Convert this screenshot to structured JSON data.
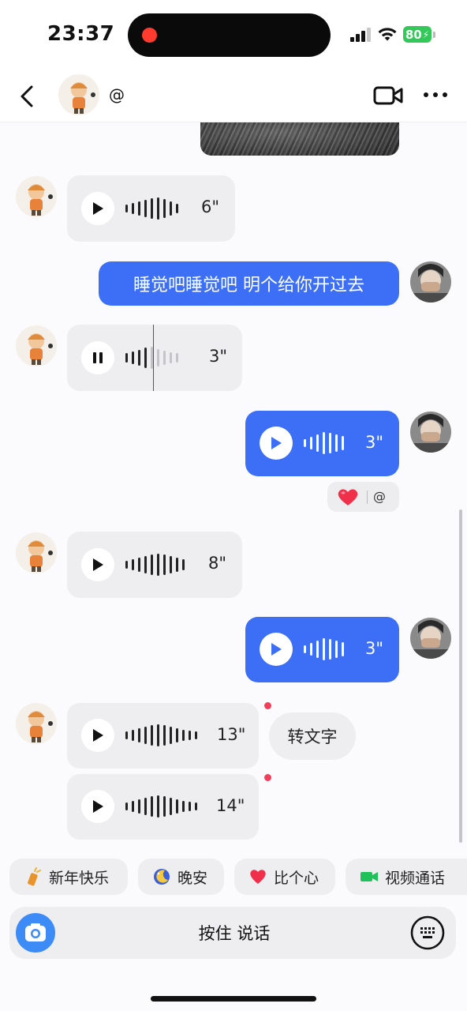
{
  "status_bar": {
    "time": "23:37",
    "battery": "80",
    "icons": [
      "signal-icon",
      "wifi-icon",
      "battery-charging-icon"
    ]
  },
  "header": {
    "contact_name": "@",
    "icons": [
      "back-arrow-icon",
      "video-camera-icon",
      "more-dots-icon"
    ]
  },
  "messages": [
    {
      "from": "me",
      "type": "image"
    },
    {
      "from": "them",
      "type": "voice",
      "duration": "6\"",
      "state": "stopped"
    },
    {
      "from": "me",
      "type": "text",
      "text": "睡觉吧睡觉吧 明个给你开过去"
    },
    {
      "from": "them",
      "type": "voice",
      "duration": "3\"",
      "state": "playing",
      "progress": 0.45
    },
    {
      "from": "me",
      "type": "voice",
      "duration": "3\"",
      "state": "stopped",
      "reaction": {
        "emoji": "heart-icon",
        "by": "@"
      }
    },
    {
      "from": "them",
      "type": "voice",
      "duration": "8\"",
      "state": "stopped"
    },
    {
      "from": "me",
      "type": "voice",
      "duration": "3\"",
      "state": "stopped"
    },
    {
      "from": "them",
      "type": "voice",
      "duration": "13\"",
      "state": "stopped",
      "unread": true
    },
    {
      "from": "them",
      "type": "voice",
      "duration": "14\"",
      "state": "stopped",
      "unread": true
    }
  ],
  "convert_to_text": "转文字",
  "quick_replies": [
    {
      "label": "新年快乐",
      "icon": "firecracker-icon"
    },
    {
      "label": "晚安",
      "icon": "moon-icon"
    },
    {
      "label": "比个心",
      "icon": "heart-icon"
    },
    {
      "label": "视频通话",
      "icon": "video-call-icon"
    }
  ],
  "input": {
    "hold_to_talk": "按住 说话",
    "icons": [
      "camera-icon",
      "keyboard-icon"
    ]
  },
  "colors": {
    "outgoing_bubble": "#3d6ff6",
    "incoming_bubble": "#eeeef1",
    "unread_dot": "#f23d5b",
    "camera_button": "#3d8bf7"
  }
}
